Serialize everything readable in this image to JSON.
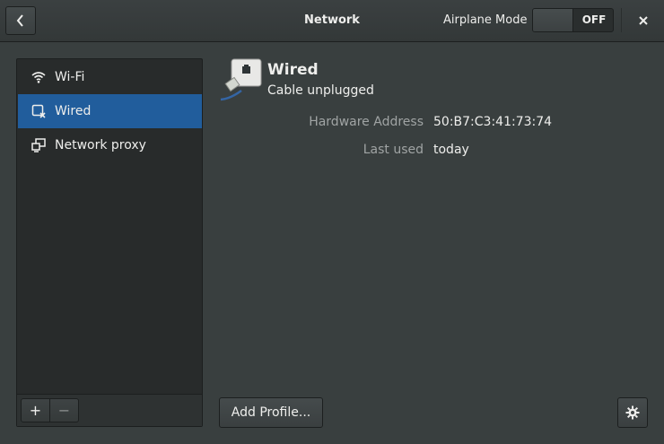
{
  "header": {
    "title": "Network",
    "airplane_mode_label": "Airplane Mode",
    "airplane_mode_state": "OFF"
  },
  "sidebar": {
    "items": [
      {
        "label": "Wi-Fi",
        "icon": "wifi-icon",
        "selected": false
      },
      {
        "label": "Wired",
        "icon": "wired-network-icon",
        "selected": true
      },
      {
        "label": "Network proxy",
        "icon": "network-proxy-icon",
        "selected": false
      }
    ],
    "footer": {
      "add_label": "+",
      "remove_label": "−"
    }
  },
  "main": {
    "device_name": "Wired",
    "device_status": "Cable unplugged",
    "details": [
      {
        "label": "Hardware Address",
        "value": "50:B7:C3:41:73:74"
      },
      {
        "label": "Last used",
        "value": "today"
      }
    ],
    "add_profile_label": "Add Profile...",
    "settings_icon": "gear-icon"
  },
  "colors": {
    "window_bg": "#393f3f",
    "sidebar_bg": "#282b2b",
    "selection": "#215d9c",
    "text": "#eeeeec",
    "dim_text": "#a0a4a4"
  }
}
